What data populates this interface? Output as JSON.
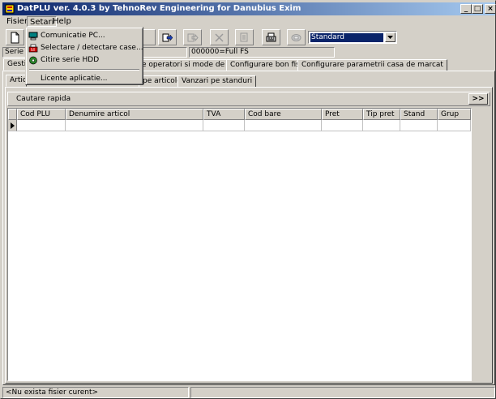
{
  "window": {
    "title": "DatPLU ver. 4.0.3 by TehnoRev Engineering for Danubius Exim",
    "minimize": "_",
    "maximize": "□",
    "close": "×"
  },
  "menu": {
    "file": "Fisier",
    "settings": "Setari",
    "help": "Help"
  },
  "settings_menu": {
    "items": [
      {
        "label": "Comunicatie PC...",
        "icon": "computer-icon"
      },
      {
        "label": "Selectare / detectare case...",
        "icon": "register-icon"
      },
      {
        "label": "Citire serie HDD",
        "icon": "disk-icon"
      },
      {
        "label": "Licente aplicatie...",
        "icon": ""
      }
    ]
  },
  "toolbar": {
    "profile_value": "Standard"
  },
  "info": {
    "serie_label": "Serie E",
    "fs_value": "000000=Full FS"
  },
  "tabs": {
    "top": [
      {
        "label": "Gestiu"
      },
      {
        "label": "e operatori si mode de lucru"
      },
      {
        "label": "Configurare bon fiscal"
      },
      {
        "label": "Configurare parametrii casa de marcat"
      }
    ],
    "sub": [
      {
        "label": "Artico"
      },
      {
        "label": "pe articole"
      },
      {
        "label": "Vanzari pe standuri"
      }
    ]
  },
  "search": {
    "label": "Cautare rapida",
    "expand_button": ">>"
  },
  "grid": {
    "columns": [
      "Cod PLU",
      "Denumire articol",
      "TVA",
      "Cod bare",
      "Pret",
      "Tip pret",
      "Stand",
      "Grup"
    ]
  },
  "status": {
    "text": "<Nu exista fisier curent>"
  }
}
